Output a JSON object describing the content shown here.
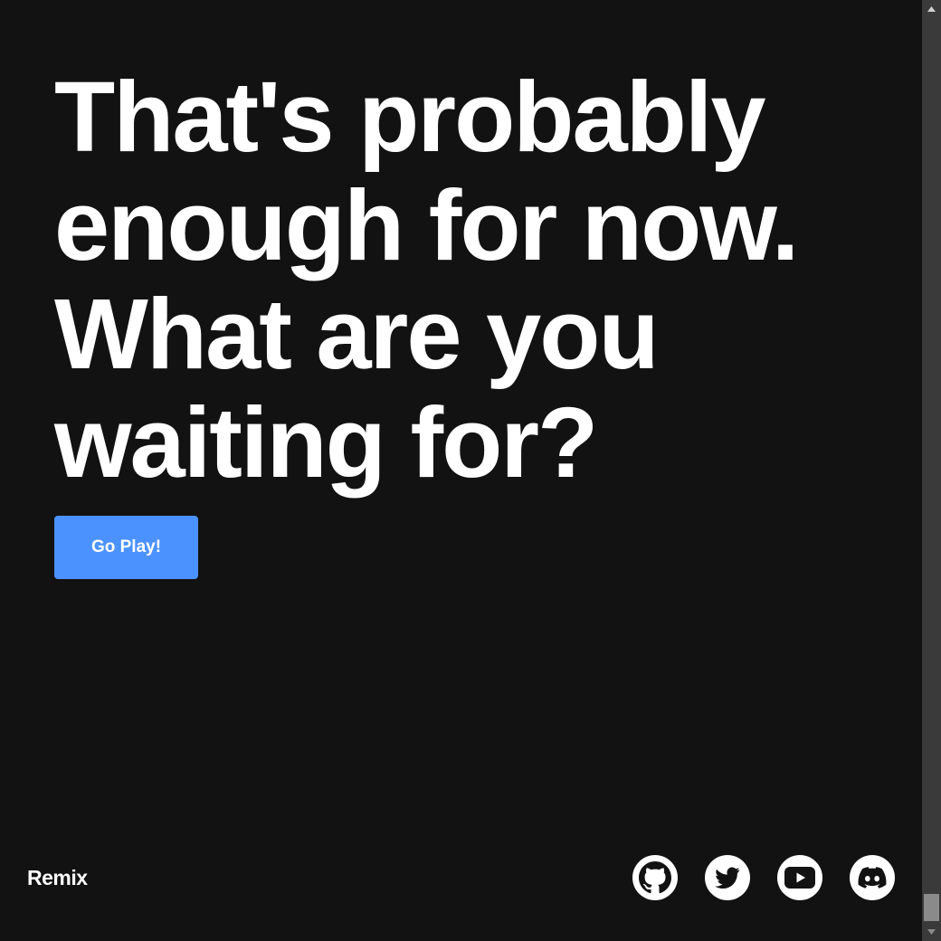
{
  "headline": {
    "lines": [
      "That's probably",
      "enough for now.",
      "What are you",
      "waiting for?"
    ]
  },
  "cta": {
    "label": "Go Play!"
  },
  "footer": {
    "logo_text": "Remix",
    "social": [
      {
        "icon": "github-icon"
      },
      {
        "icon": "twitter-icon"
      },
      {
        "icon": "youtube-icon"
      },
      {
        "icon": "discord-icon"
      }
    ]
  },
  "colors": {
    "background": "#121212",
    "accent": "#4b92ff",
    "text": "#ffffff"
  }
}
